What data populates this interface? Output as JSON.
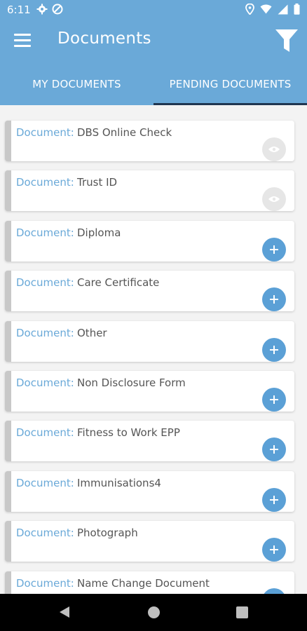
{
  "status_bar": {
    "time": "6:11"
  },
  "app_bar": {
    "title": "Documents"
  },
  "tabs": [
    {
      "label": "MY DOCUMENTS",
      "active": false
    },
    {
      "label": "PENDING DOCUMENTS",
      "active": true
    }
  ],
  "documents": [
    {
      "label": "Document:",
      "name": "DBS Online Check",
      "action": "view-icon"
    },
    {
      "label": "Document:",
      "name": "Trust ID",
      "action": "view-icon"
    },
    {
      "label": "Document:",
      "name": "Diploma",
      "action": "plus-icon"
    },
    {
      "label": "Document:",
      "name": "Care Certificate",
      "action": "plus-icon"
    },
    {
      "label": "Document:",
      "name": "Other",
      "action": "plus-icon"
    },
    {
      "label": "Document:",
      "name": "Non Disclosure Form",
      "action": "plus-icon"
    },
    {
      "label": "Document:",
      "name": "Fitness to Work EPP",
      "action": "plus-icon"
    },
    {
      "label": "Document:",
      "name": "Immunisations4",
      "action": "plus-icon"
    },
    {
      "label": "Document:",
      "name": "Photograph",
      "action": "plus-icon"
    },
    {
      "label": "Document:",
      "name": "Name Change Document",
      "action": "plus-icon"
    }
  ],
  "colors": {
    "primary": "#6aa9d8",
    "active_tab_indicator": "#1f3550",
    "add_button": "#5ba0d6",
    "view_button_disabled": "#e6e6e6"
  }
}
